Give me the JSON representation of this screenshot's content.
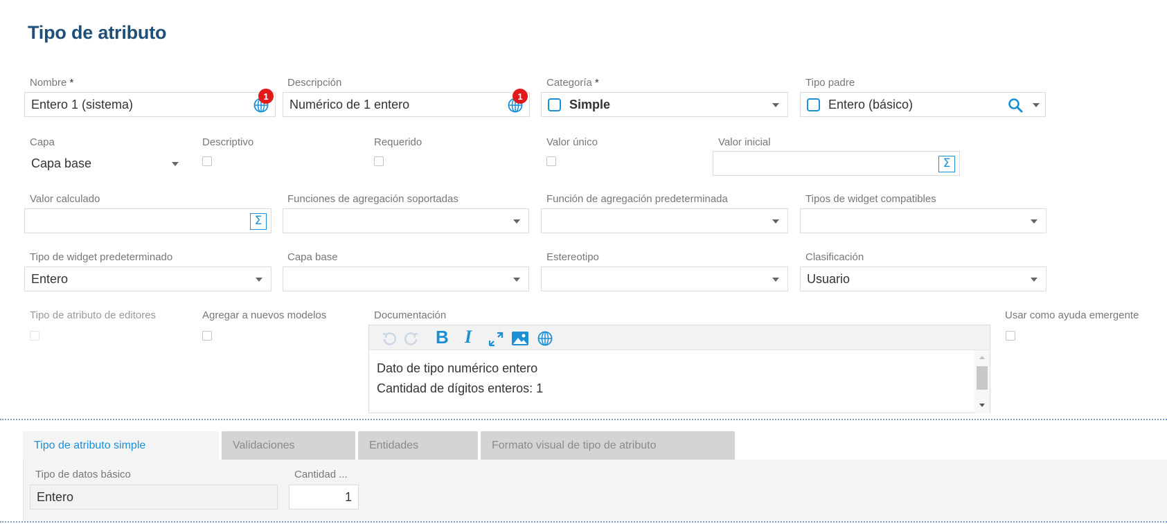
{
  "page_title": "Tipo de atributo",
  "required_mark": "*",
  "row1": {
    "nombre": {
      "label": "Nombre",
      "value": "Entero 1 (sistema)",
      "badge": "1",
      "icon": "globe-icon"
    },
    "descripcion": {
      "label": "Descripción",
      "value": "Numérico de 1 entero",
      "badge": "1",
      "icon": "globe-icon"
    },
    "categoria": {
      "label": "Categoría",
      "value": "Simple"
    },
    "tipo_padre": {
      "label": "Tipo padre",
      "value": "Entero (básico)"
    }
  },
  "row2": {
    "capa": {
      "label": "Capa",
      "value": "Capa base"
    },
    "descriptivo": {
      "label": "Descriptivo",
      "checked": false
    },
    "requerido": {
      "label": "Requerido",
      "checked": false
    },
    "valor_unico": {
      "label": "Valor único",
      "checked": false
    },
    "valor_inicial": {
      "label": "Valor inicial",
      "value": ""
    }
  },
  "row3": {
    "valor_calculado": {
      "label": "Valor calculado",
      "value": ""
    },
    "funciones_agregacion": {
      "label": "Funciones de agregación soportadas",
      "value": ""
    },
    "funcion_predeterminada": {
      "label": "Función de agregación predeterminada",
      "value": ""
    },
    "tipos_widget": {
      "label": "Tipos de widget compatibles",
      "value": ""
    }
  },
  "row4": {
    "widget_predeterminado": {
      "label": "Tipo de widget predeterminado",
      "value": "Entero"
    },
    "capa_base": {
      "label": "Capa base",
      "value": ""
    },
    "estereotipo": {
      "label": "Estereotipo",
      "value": ""
    },
    "clasificacion": {
      "label": "Clasificación",
      "value": "Usuario"
    }
  },
  "row5": {
    "tipo_editores": {
      "label": "Tipo de atributo de editores",
      "checked": false,
      "disabled": true
    },
    "agregar_modelos": {
      "label": "Agregar a nuevos modelos",
      "checked": false
    },
    "documentacion": {
      "label": "Documentación",
      "lines": [
        "Dato de tipo numérico entero",
        "Cantidad de dígitos enteros: 1"
      ],
      "toolbar_icons": [
        "undo-icon",
        "redo-icon",
        "bold-icon",
        "italic-icon",
        "expand-icon",
        "image-icon",
        "globe-icon"
      ],
      "bold_glyph": "B",
      "italic_glyph": "I"
    },
    "ayuda_emergente": {
      "label": "Usar como ayuda emergente",
      "checked": false
    }
  },
  "tabs": [
    {
      "label": "Tipo de atributo simple",
      "active": true
    },
    {
      "label": "Validaciones",
      "active": false
    },
    {
      "label": "Entidades",
      "active": false
    },
    {
      "label": "Formato visual de tipo de atributo",
      "active": false
    }
  ],
  "tab_panel": {
    "tipo_datos": {
      "label": "Tipo de datos básico",
      "value": "Entero"
    },
    "cantidad": {
      "label": "Cantidad ...",
      "value": "1"
    }
  },
  "colors": {
    "accent": "#1a8fd6",
    "title": "#1f4e79",
    "badge": "#e01a1a"
  }
}
